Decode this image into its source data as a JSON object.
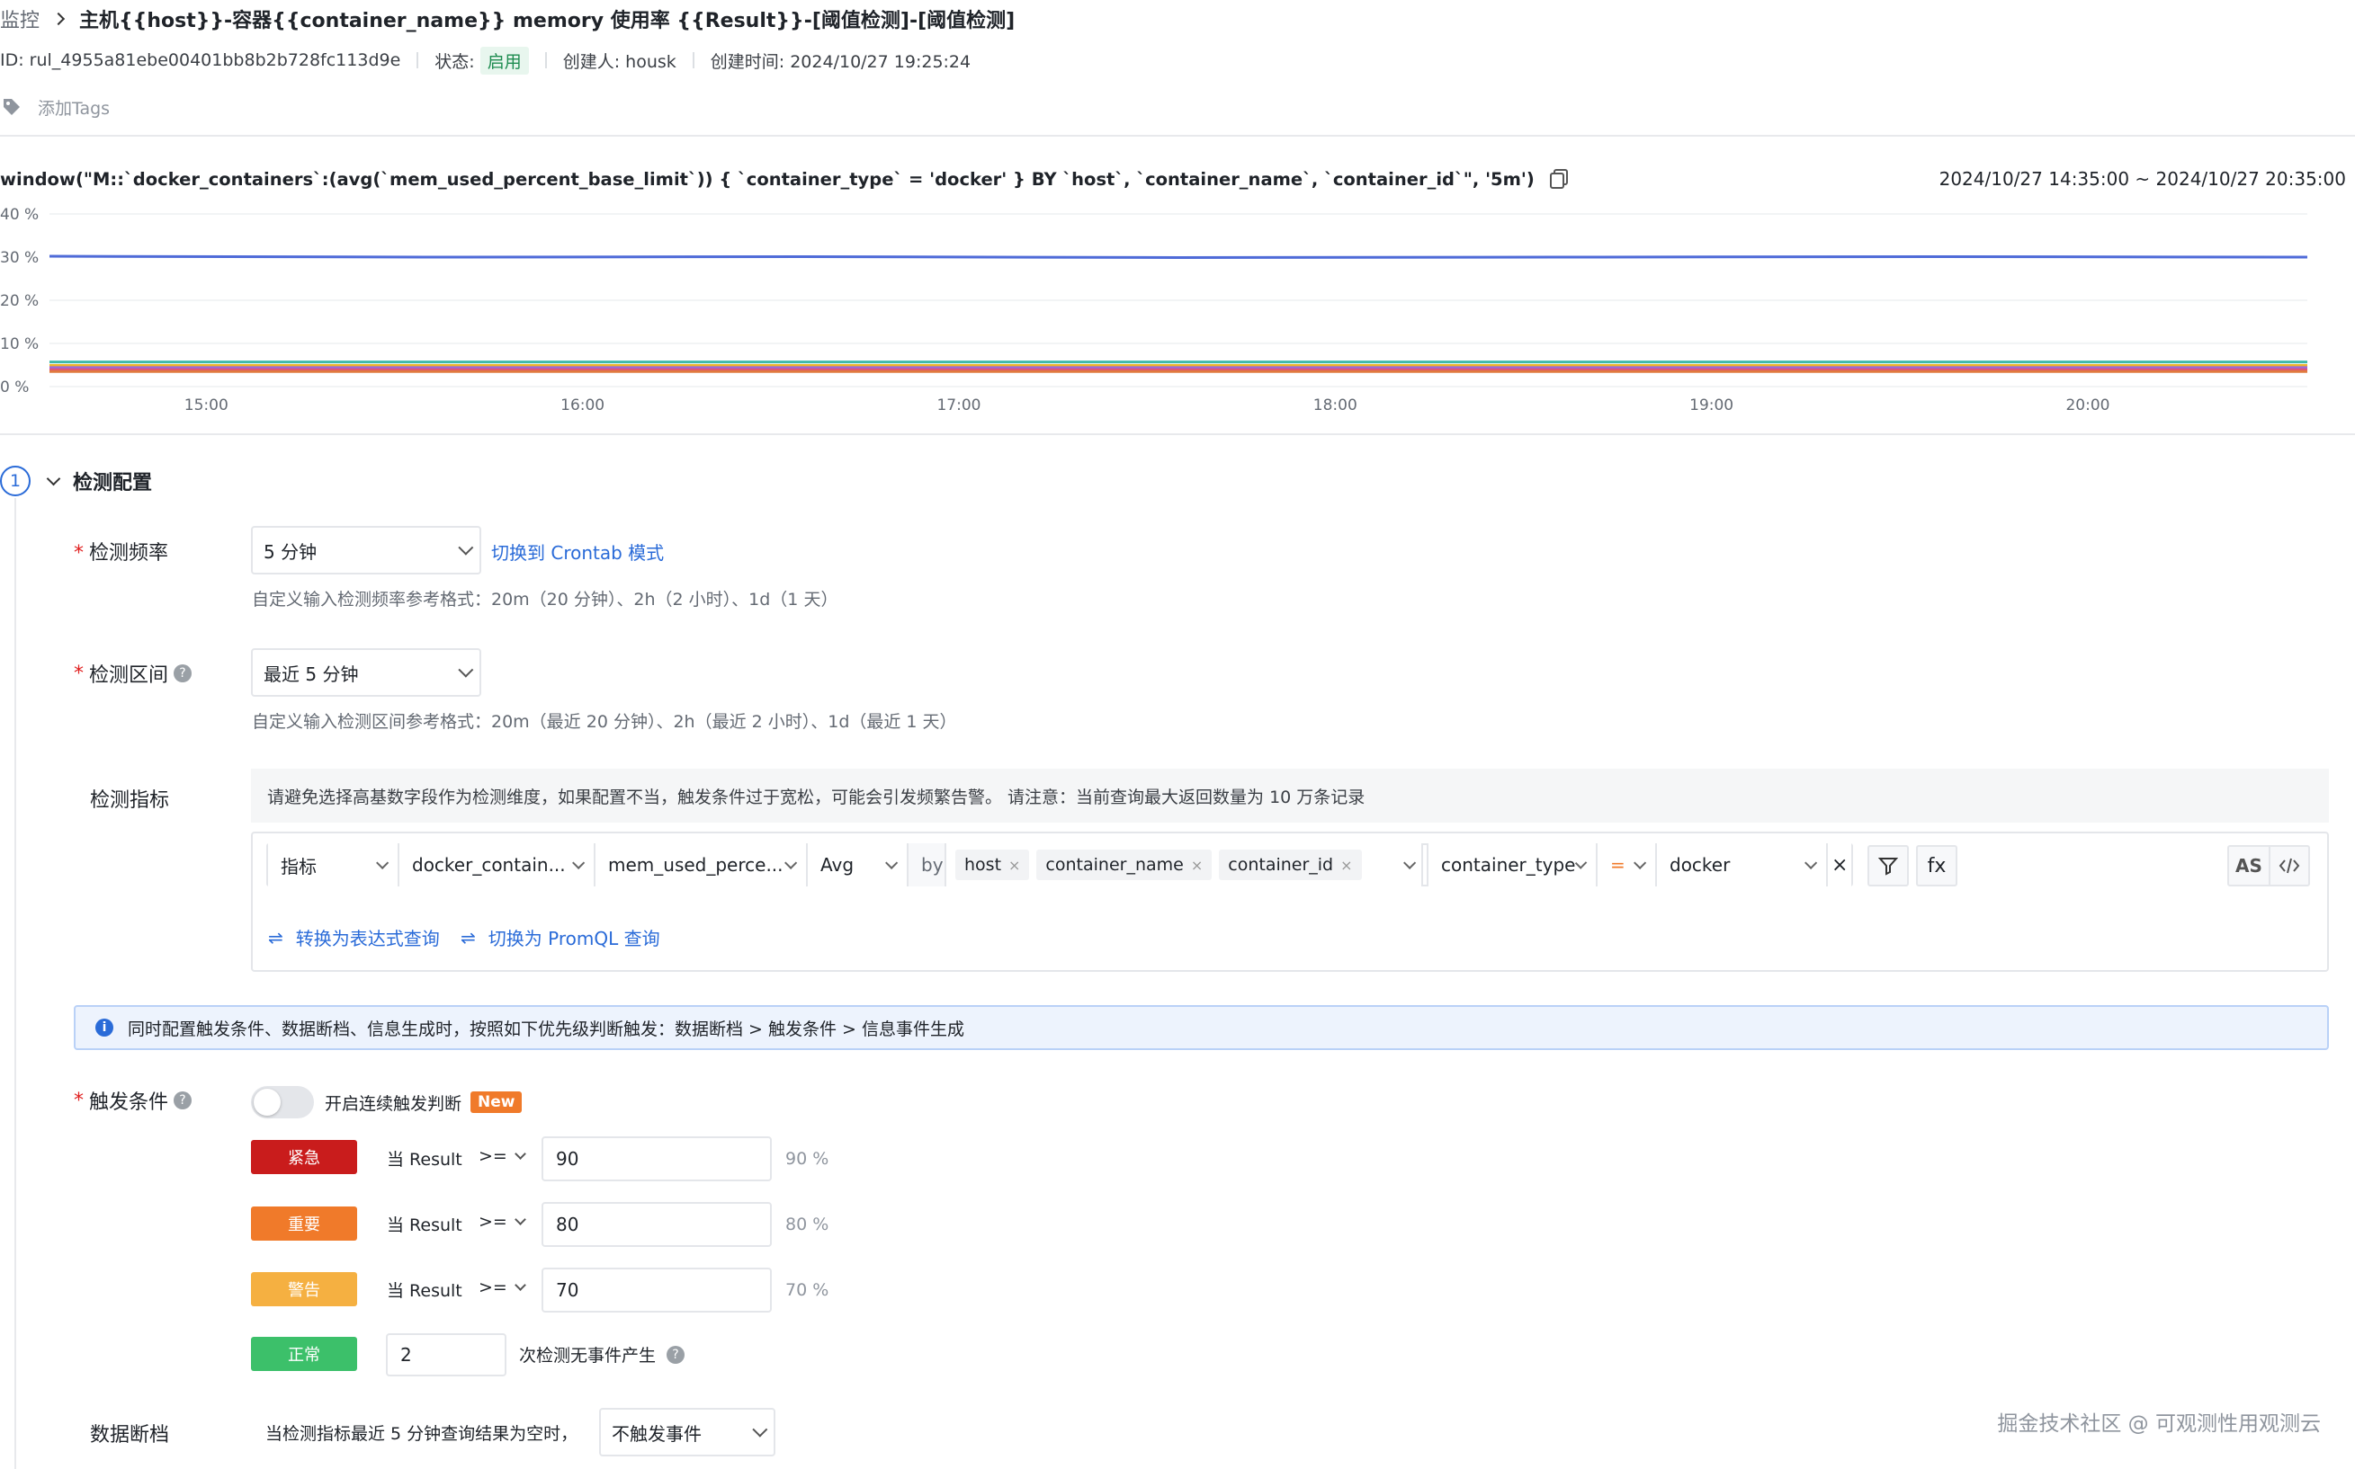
{
  "breadcrumb": {
    "root": "监控",
    "separator": ">",
    "title": "主机{{host}}-容器{{container_name}} memory 使用率 {{Result}}-[阈值检测]-[阈值检测]"
  },
  "meta": {
    "id": "ID: rul_4955a81ebe00401bb8b2b728fc113d9e",
    "status_label": "状态:",
    "status_value": "启用",
    "creator": "创建人: housk",
    "created_time": "创建时间: 2024/10/27 19:25:24"
  },
  "tags": {
    "add_label": "添加Tags"
  },
  "query": {
    "text": "window(\"M::`docker_containers`:(avg(`mem_used_percent_base_limit`)) { `container_type` = 'docker' } BY `host`, `container_name`, `container_id`\", '5m')",
    "time_range": "2024/10/27 14:35:00 ~ 2024/10/27 20:35:00"
  },
  "chart_data": {
    "type": "line",
    "y_ticks": [
      "40 %",
      "30 %",
      "20 %",
      "10 %",
      "0 %"
    ],
    "x_ticks": [
      "15:00",
      "16:00",
      "17:00",
      "18:00",
      "19:00",
      "20:00"
    ],
    "ylim": [
      0,
      40
    ],
    "x_range": [
      "14:35",
      "20:35"
    ],
    "series": [
      {
        "color": "#4f6bd8",
        "x": [
          "14:35",
          "15:35",
          "16:35",
          "17:35",
          "18:35",
          "19:35",
          "20:35"
        ],
        "values": [
          30.2,
          30.0,
          30.1,
          29.9,
          30.0,
          30.1,
          30.0
        ]
      },
      {
        "color": "#3fb8a8",
        "x": [
          "14:35",
          "20:35"
        ],
        "values": [
          5.7,
          5.7
        ]
      },
      {
        "color": "#f0b429",
        "x": [
          "14:35",
          "20:35"
        ],
        "values": [
          4.9,
          4.9
        ]
      },
      {
        "color": "#9b6bd8",
        "x": [
          "14:35",
          "20:35"
        ],
        "values": [
          4.4,
          4.4
        ]
      },
      {
        "color": "#e0507a",
        "x": [
          "14:35",
          "20:35"
        ],
        "values": [
          3.9,
          3.9
        ]
      },
      {
        "color": "#e07a3f",
        "x": [
          "14:35",
          "20:35"
        ],
        "values": [
          3.5,
          3.5
        ]
      }
    ]
  },
  "section": {
    "step": "1",
    "title": "检测配置"
  },
  "freq": {
    "label": "检测频率",
    "value": "5 分钟",
    "switch_link": "切换到 Crontab 模式",
    "hint": "自定义输入检测频率参考格式：20m（20 分钟）、2h（2 小时）、1d（1 天）"
  },
  "interval": {
    "label": "检测区间",
    "value": "最近 5 分钟",
    "hint": "自定义输入检测区间参考格式：20m（最近 20 分钟）、2h（最近 2 小时）、1d（最近 1 天）"
  },
  "metric": {
    "label": "检测指标",
    "warning": "请避免选择高基数字段作为检测维度，如果配置不当，触发条件过于宽松，可能会引发频繁告警。 请注意：当前查询最大返回数量为 10 万条记录",
    "type": "指标",
    "measurement": "docker_contain...",
    "field": "mem_used_perce...",
    "agg": "Avg",
    "by": "by",
    "group_tags": [
      "host",
      "container_name",
      "container_id"
    ],
    "filter_key": "container_type",
    "filter_op": "=",
    "filter_value": "docker",
    "as_label": "AS",
    "fx_label": "fx",
    "convert_expr": "转换为表达式查询",
    "convert_promql": "切换为 PromQL 查询"
  },
  "info_banner": "同时配置触发条件、数据断档、信息生成时，按照如下优先级判断触发：数据断档 > 触发条件 > 信息事件生成",
  "trigger": {
    "label": "触发条件",
    "toggle_label": "开启连续触发判断",
    "new_badge": "New",
    "rules": [
      {
        "level": "紧急",
        "color": "#c91c1c",
        "prefix": "当 Result",
        "op": ">=",
        "value": "90",
        "unit": "90 %"
      },
      {
        "level": "重要",
        "color": "#f07a2a",
        "prefix": "当 Result",
        "op": ">=",
        "value": "80",
        "unit": "80 %"
      },
      {
        "level": "警告",
        "color": "#f5b041",
        "prefix": "当 Result",
        "op": ">=",
        "value": "70",
        "unit": "70 %"
      }
    ],
    "normal": {
      "level": "正常",
      "color": "#3cc06a",
      "value": "2",
      "suffix": "次检测无事件产生"
    }
  },
  "nodata": {
    "label": "数据断档",
    "text": "当检测指标最近 5 分钟查询结果为空时，",
    "value": "不触发事件"
  },
  "watermark": "掘金技术社区 @ 可观测性用观测云"
}
